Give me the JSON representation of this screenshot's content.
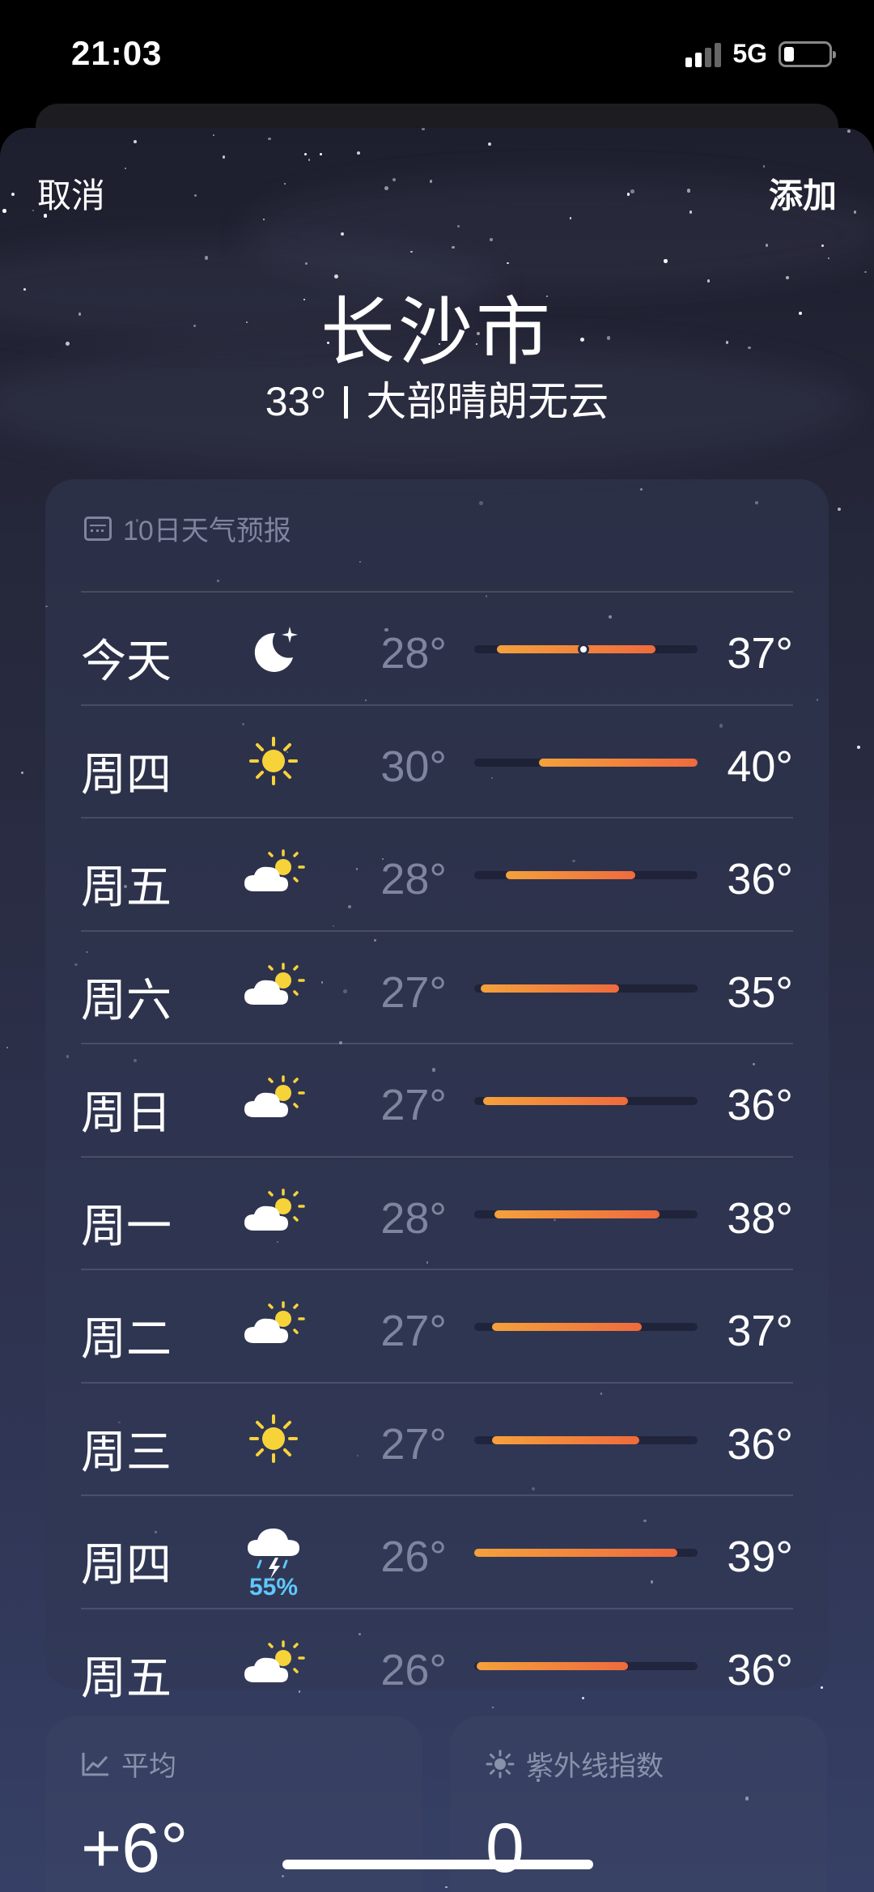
{
  "status_bar": {
    "time": "21:03",
    "network": "5G"
  },
  "nav": {
    "cancel": "取消",
    "add": "添加"
  },
  "location": {
    "city": "长沙市",
    "temp": "33°",
    "condition": "大部晴朗无云"
  },
  "forecast": {
    "title": "10日天气预报",
    "days": [
      {
        "day": "今天",
        "icon": "moon-icon",
        "low": "28°",
        "high": "37°",
        "bar_start": 0.1,
        "bar_end": 0.81,
        "current_marker": 0.49
      },
      {
        "day": "周四",
        "icon": "sun-icon",
        "low": "30°",
        "high": "40°",
        "bar_start": 0.29,
        "bar_end": 1.0
      },
      {
        "day": "周五",
        "icon": "partly-cloudy-icon",
        "low": "28°",
        "high": "36°",
        "bar_start": 0.14,
        "bar_end": 0.72
      },
      {
        "day": "周六",
        "icon": "partly-cloudy-icon",
        "low": "27°",
        "high": "35°",
        "bar_start": 0.03,
        "bar_end": 0.65
      },
      {
        "day": "周日",
        "icon": "partly-cloudy-icon",
        "low": "27°",
        "high": "36°",
        "bar_start": 0.04,
        "bar_end": 0.69
      },
      {
        "day": "周一",
        "icon": "partly-cloudy-icon",
        "low": "28°",
        "high": "38°",
        "bar_start": 0.09,
        "bar_end": 0.83
      },
      {
        "day": "周二",
        "icon": "partly-cloudy-icon",
        "low": "27°",
        "high": "37°",
        "bar_start": 0.08,
        "bar_end": 0.75
      },
      {
        "day": "周三",
        "icon": "sun-icon",
        "low": "27°",
        "high": "36°",
        "bar_start": 0.08,
        "bar_end": 0.74
      },
      {
        "day": "周四",
        "icon": "thunderstorm-icon",
        "precip": "55%",
        "low": "26°",
        "high": "39°",
        "bar_start": 0.0,
        "bar_end": 0.91
      },
      {
        "day": "周五",
        "icon": "partly-cloudy-icon",
        "low": "26°",
        "high": "36°",
        "bar_start": 0.01,
        "bar_end": 0.69
      }
    ]
  },
  "average_card": {
    "title": "平均",
    "value": "+6°",
    "icon": "trend-chart-icon"
  },
  "uv_card": {
    "title": "紫外线指数",
    "value": "0",
    "icon": "sun-small-icon"
  },
  "colors": {
    "low_temp": "#7f859e",
    "bar_start": "#f4a13c",
    "bar_end": "#ef6a3d",
    "precip": "#5ec8fa"
  }
}
